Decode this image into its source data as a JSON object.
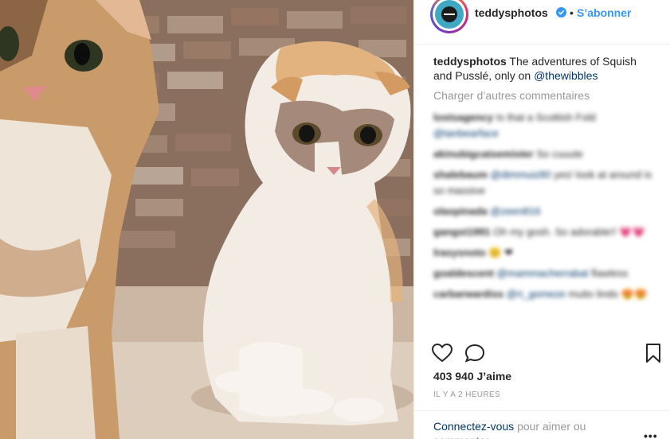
{
  "photo": {
    "description_colors": {
      "wall": "#8a6e5e",
      "floor": "#d6c8b8",
      "cat_left": "#c99a6a",
      "cat_right": "#f2e9df"
    }
  },
  "header": {
    "username": "teddysphotos",
    "separator": "•",
    "follow_label": "S’abonner"
  },
  "caption": {
    "username": "teddysphotos",
    "text": "The adventures of Squish and Pusslé, only on",
    "mention": "@thewibbles"
  },
  "load_more": "Charger d’autres commentaires",
  "comments": [
    {
      "user": "lostsagency",
      "text": "Is that a Scottish Fold",
      "mention": "@tanbearface"
    },
    {
      "user": "akinubigcatsemister",
      "text": "So cuuute",
      "mention": ""
    },
    {
      "user": "shalebaum",
      "text": "yes! look at around is so massive",
      "mention": "@dimmuiz80"
    },
    {
      "user": "olaspinada",
      "text": "",
      "mention": "@zeen816"
    },
    {
      "user": "gangst1991",
      "text": "Oh my gosh. So adorable!! 💗💗",
      "mention": ""
    },
    {
      "user": "lrasysnoto",
      "text": "😊 ❤",
      "mention": ""
    },
    {
      "user": "goaldescent",
      "text": "flawless",
      "mention": "@mammacherrabat"
    },
    {
      "user": "carbarwardiss",
      "text": "muito lindo 😍😍",
      "mention": "@ri_gomeze"
    }
  ],
  "stats": {
    "likes": "403 940 J’aime",
    "time": "IL Y A 2 HEURES"
  },
  "login": {
    "link": "Connectez-vous",
    "text": "pour aimer ou commenter.",
    "more": "•••"
  },
  "colors": {
    "accent": "#3897f0",
    "text": "#262626",
    "muted": "#999999",
    "mention": "#003569"
  }
}
